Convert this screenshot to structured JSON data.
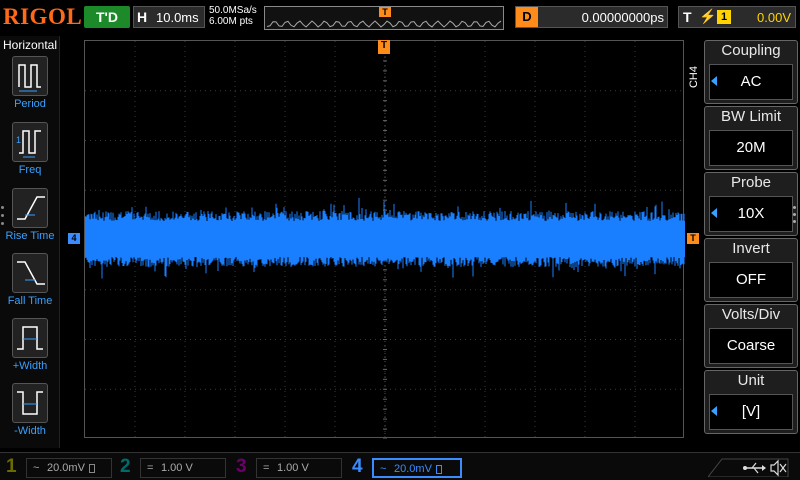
{
  "brand": "RIGOL",
  "run_state": "T'D",
  "horizontal": {
    "tag": "H",
    "timebase": "10.0ms",
    "sample_rate": "50.0MSa/s",
    "mem_depth": "6.00M pts"
  },
  "delay": {
    "tag": "D",
    "value": "0.00000000ps"
  },
  "trigger": {
    "tag": "T",
    "edge_icon": "rising-edge-icon",
    "source": "1",
    "level": "0.00V"
  },
  "left_menu": {
    "title": "Horizontal",
    "items": [
      {
        "label": "Period",
        "icon": "period-icon"
      },
      {
        "label": "Freq",
        "icon": "frequency-icon"
      },
      {
        "label": "Rise Time",
        "icon": "rise-time-icon"
      },
      {
        "label": "Fall Time",
        "icon": "fall-time-icon"
      },
      {
        "label": "+Width",
        "icon": "positive-width-icon"
      },
      {
        "label": "-Width",
        "icon": "negative-width-icon"
      }
    ]
  },
  "right_menu": {
    "channel_label": "CH4",
    "items": [
      {
        "label": "Coupling",
        "value": "AC",
        "has_arrow": true
      },
      {
        "label": "BW Limit",
        "value": "20M",
        "has_arrow": false
      },
      {
        "label": "Probe",
        "value": "10X",
        "has_arrow": true
      },
      {
        "label": "Invert",
        "value": "OFF",
        "has_arrow": false
      },
      {
        "label": "Volts/Div",
        "value": "Coarse",
        "has_arrow": false
      },
      {
        "label": "Unit",
        "value": "[V]",
        "has_arrow": true
      }
    ]
  },
  "markers": {
    "channel": "4",
    "trigger_top": "T",
    "trigger_right": "T"
  },
  "channels": [
    {
      "number": "1",
      "coupling_icon": "~",
      "scale": "20.0mV",
      "color": "#c8c800",
      "active": false
    },
    {
      "number": "2",
      "coupling_icon": "=",
      "scale": "1.00 V",
      "color": "#00c8c8",
      "active": false
    },
    {
      "number": "3",
      "coupling_icon": "=",
      "scale": "1.00 V",
      "color": "#c800c8",
      "active": false
    },
    {
      "number": "4",
      "coupling_icon": "~",
      "scale": "20.0mV",
      "color": "#3a8cff",
      "active": true
    }
  ],
  "status_icons": [
    "usb-icon",
    "speaker-muted-icon"
  ],
  "colors": {
    "trace": "#1a7fff",
    "trigger": "#ff8c1a",
    "brand": "#ff6a1a",
    "run": "#1d8a2a"
  }
}
